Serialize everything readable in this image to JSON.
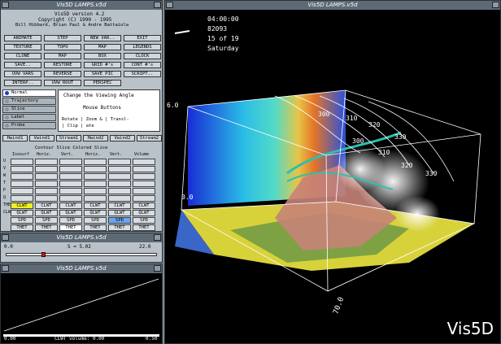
{
  "control_window": {
    "title": "Vis5D LAMPS.v5d",
    "header": [
      "Vis5D version 4.2",
      "Copyright (C) 1990 - 1995",
      "Bill Hibbard, Brian Paul & Andre Battaiola"
    ],
    "buttons_row1": [
      "ANIMATE",
      "STEP",
      "NEW VAR..",
      "EXIT"
    ],
    "buttons_row2": [
      "TEXTURE",
      "TOPO",
      "MAP",
      "LEGENDS"
    ],
    "buttons_row3": [
      "CLONE",
      "MAP",
      "BOX",
      "CLOCK"
    ],
    "buttons_row4": [
      "SAVE..",
      "RESTORE",
      "GRID #'s",
      "CONT #'s"
    ],
    "buttons_row5": [
      "UVW VARS",
      "REVERSE",
      "SAVE PIC",
      "SCRIPT.."
    ],
    "buttons_row6": [
      "INTERP..",
      "UVW ROUT",
      "PERSPEC"
    ],
    "modes": [
      {
        "label": "Normal",
        "selected": true
      },
      {
        "label": "Trajectory",
        "selected": false
      },
      {
        "label": "Slice",
        "selected": false
      },
      {
        "label": "Label",
        "selected": false
      },
      {
        "label": "Probe",
        "selected": false
      }
    ],
    "help_title": "Change the Viewing Angle",
    "help_sub": "Mouse Buttons",
    "help_rows": [
      "Rotate | Zoom & | Transl-",
      "      | Clip  | ate"
    ],
    "wind_buttons": [
      "Hwind1",
      "Vwind1",
      "Stream1",
      "Hwind2",
      "Vwind2",
      "Stream2"
    ],
    "table_header1": "Contour Slice   Colored Slice",
    "table_header2": [
      "Isosurf",
      "Horiz.",
      "Vert.",
      "Horiz.",
      "Vert.",
      "Volume"
    ],
    "var_col_left": [
      "U",
      "V",
      "W",
      "T",
      "P",
      "Q",
      "THET",
      "CLWT"
    ],
    "var_col_right": [
      "U",
      "V",
      "W",
      "T",
      "P",
      "Q",
      "THET",
      "CLWT"
    ],
    "grid_rows": [
      [
        "",
        "",
        "",
        "",
        "",
        ""
      ],
      [
        "",
        "",
        "",
        "",
        "",
        ""
      ],
      [
        "",
        "",
        "",
        "",
        "",
        ""
      ],
      [
        "",
        "",
        "",
        "",
        "",
        ""
      ],
      [
        "",
        "",
        "",
        "",
        "",
        ""
      ],
      [
        "",
        "",
        "",
        "",
        "",
        ""
      ],
      [
        "CLWT",
        "CLWT",
        "CLWT",
        "CLWT",
        "CLWT",
        "CLWT"
      ],
      [
        "QLWT",
        "QLWT",
        "QLWT",
        "QLWT",
        "QLWT",
        "QLWT"
      ],
      [
        "SPD",
        "SPD",
        "SPD",
        "SPD",
        "SPD",
        "SPD"
      ],
      [
        "THET",
        "THET",
        "THET",
        "THET",
        "THET",
        "THET"
      ]
    ]
  },
  "slider_window": {
    "title": "Vis5D LAMPS.v5d",
    "min": "0.0",
    "mid": "S = 5.02",
    "max": "22.0",
    "value_fraction": 0.24
  },
  "graph_window": {
    "title": "Vis5D LAMPS.v5d",
    "x_min": "0.00",
    "caption": "CLWT volume: 0.00",
    "x_max": "0.50"
  },
  "view_window": {
    "title": "Vis5D LAMPS.v5d",
    "clock": [
      "04:00:00",
      "82093",
      "15 of 19",
      "Saturday"
    ],
    "contours": [
      "300",
      "310",
      "320",
      "330",
      "300",
      "310",
      "320",
      "330"
    ],
    "axis_top": "6.0",
    "axis_bottom": "0.0",
    "corner_label": "70.0",
    "brand": "Vis5D"
  },
  "colors": {
    "panel": "#b9c2c9",
    "title": "#5d6a76",
    "highlight_yellow": "#f2ee22",
    "highlight_blue": "#6aa6f2"
  }
}
